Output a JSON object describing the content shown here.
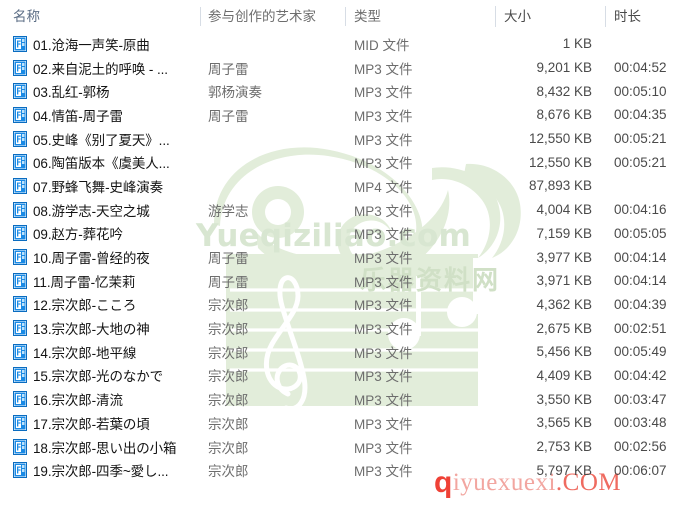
{
  "columns": [
    {
      "key": "name",
      "label": "名称"
    },
    {
      "key": "artist",
      "label": "参与创作的艺术家"
    },
    {
      "key": "type",
      "label": "类型"
    },
    {
      "key": "size",
      "label": "大小"
    },
    {
      "key": "duration",
      "label": "时长"
    }
  ],
  "icon": {
    "name": "media-file-icon",
    "color": "#1a7fd4"
  },
  "watermark": {
    "brand_latin": "Yueqiziliao.com",
    "brand_cn": "乐器资料网",
    "bottom_q": "q",
    "bottom_text": "iyuexuexi",
    "bottom_com": ".COM",
    "color_green": "#e2edda",
    "color_red": "#ef4136"
  },
  "rows": [
    {
      "name": "01.沧海一声笑-原曲",
      "artist": "",
      "type": "MID 文件",
      "size": "1 KB",
      "duration": ""
    },
    {
      "name": "02.来自泥土的呼唤 - ...",
      "artist": "周子雷",
      "type": "MP3 文件",
      "size": "9,201 KB",
      "duration": "00:04:52"
    },
    {
      "name": "03.乱红-郭杨",
      "artist": "郭杨演奏",
      "type": "MP3 文件",
      "size": "8,432 KB",
      "duration": "00:05:10"
    },
    {
      "name": "04.情笛-周子雷",
      "artist": "周子雷",
      "type": "MP3 文件",
      "size": "8,676 KB",
      "duration": "00:04:35"
    },
    {
      "name": "05.史峰《别了夏天》...",
      "artist": "",
      "type": "MP3 文件",
      "size": "12,550 KB",
      "duration": "00:05:21"
    },
    {
      "name": "06.陶笛版本《虞美人...",
      "artist": "",
      "type": "MP3 文件",
      "size": "12,550 KB",
      "duration": "00:05:21"
    },
    {
      "name": "07.野蜂飞舞-史峰演奏",
      "artist": "",
      "type": "MP4 文件",
      "size": "87,893 KB",
      "duration": ""
    },
    {
      "name": "08.游学志-天空之城",
      "artist": "游学志",
      "type": "MP3 文件",
      "size": "4,004 KB",
      "duration": "00:04:16"
    },
    {
      "name": "09.赵方-葬花吟",
      "artist": "",
      "type": "MP3 文件",
      "size": "7,159 KB",
      "duration": "00:05:05"
    },
    {
      "name": "10.周子雷-曾经的夜",
      "artist": "周子雷",
      "type": "MP3 文件",
      "size": "3,977 KB",
      "duration": "00:04:14"
    },
    {
      "name": "11.周子雷-忆茉莉",
      "artist": "周子雷",
      "type": "MP3 文件",
      "size": "3,971 KB",
      "duration": "00:04:14"
    },
    {
      "name": "12.宗次郎-こころ",
      "artist": "宗次郎",
      "type": "MP3 文件",
      "size": "4,362 KB",
      "duration": "00:04:39"
    },
    {
      "name": "13.宗次郎-大地の神",
      "artist": "宗次郎",
      "type": "MP3 文件",
      "size": "2,675 KB",
      "duration": "00:02:51"
    },
    {
      "name": "14.宗次郎-地平線",
      "artist": "宗次郎",
      "type": "MP3 文件",
      "size": "5,456 KB",
      "duration": "00:05:49"
    },
    {
      "name": "15.宗次郎-光のなかで",
      "artist": "宗次郎",
      "type": "MP3 文件",
      "size": "4,409 KB",
      "duration": "00:04:42"
    },
    {
      "name": "16.宗次郎-清流",
      "artist": "宗次郎",
      "type": "MP3 文件",
      "size": "3,550 KB",
      "duration": "00:03:47"
    },
    {
      "name": "17.宗次郎-若葉の頃",
      "artist": "宗次郎",
      "type": "MP3 文件",
      "size": "3,565 KB",
      "duration": "00:03:48"
    },
    {
      "name": "18.宗次郎-思い出の小箱",
      "artist": "宗次郎",
      "type": "MP3 文件",
      "size": "2,753 KB",
      "duration": "00:02:56"
    },
    {
      "name": "19.宗次郎-四季~愛し...",
      "artist": "宗次郎",
      "type": "MP3 文件",
      "size": "5,797 KB",
      "duration": "00:06:07"
    }
  ]
}
